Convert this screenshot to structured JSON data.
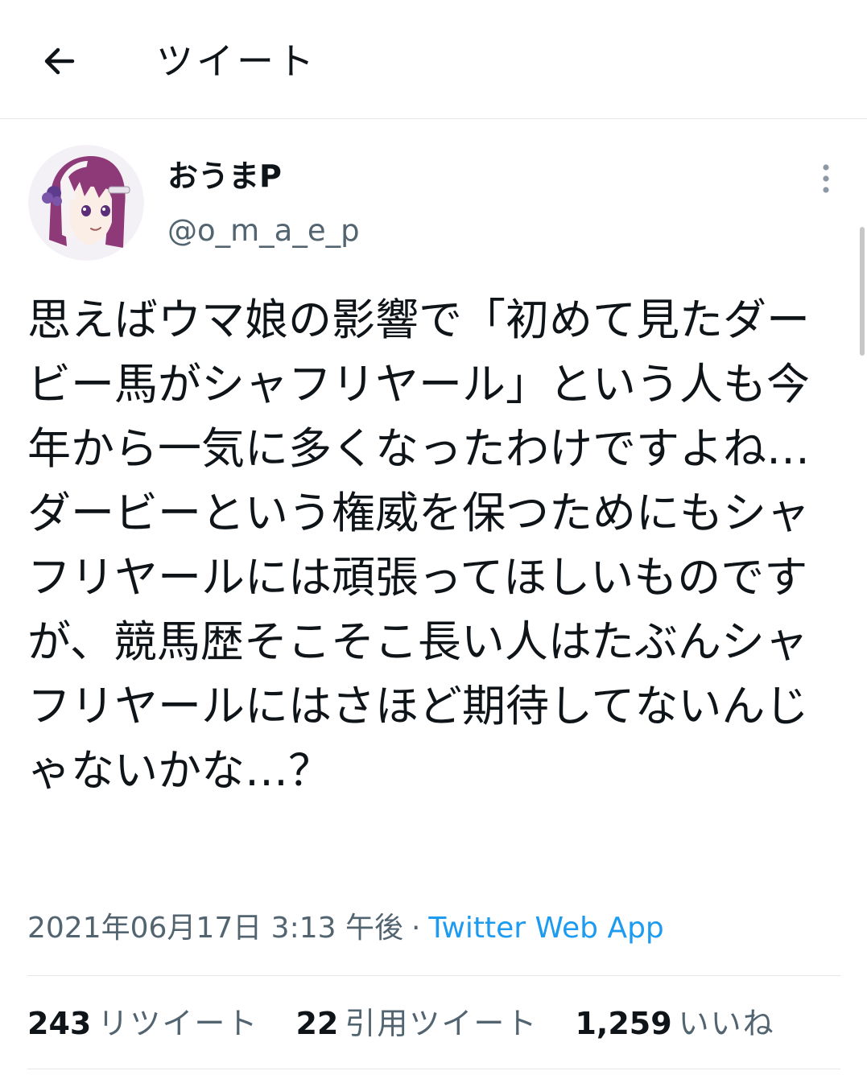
{
  "header": {
    "title": "ツイート",
    "back_icon": "arrow-left-icon"
  },
  "author": {
    "display_name": "おうまP",
    "handle": "@o_m_a_e_p",
    "avatar_icon": "avatar-anime-girl-icon",
    "more_icon": "more-vertical-icon"
  },
  "tweet": {
    "text": "思えばウマ娘の影響で「初めて見たダービー馬がシャフリヤール」という人も今年から一気に多くなったわけですよね…\nダービーという権威を保つためにもシャフリヤールには頑張ってほしいものですが、競馬歴そこそこ長い人はたぶんシャフリヤールにはさほど期待してないんじゃないかな…？",
    "timestamp": "2021年06月17日 3:13 午後",
    "separator": "·",
    "source": "Twitter Web App"
  },
  "stats": {
    "retweets": {
      "count": "243",
      "label": "リツイート"
    },
    "quotes": {
      "count": "22",
      "label": "引用ツイート"
    },
    "likes": {
      "count": "1,259",
      "label": "いいね"
    }
  },
  "colors": {
    "accent": "#1d9bf0",
    "secondary_text": "#536471",
    "divider": "#e6e6e6"
  }
}
